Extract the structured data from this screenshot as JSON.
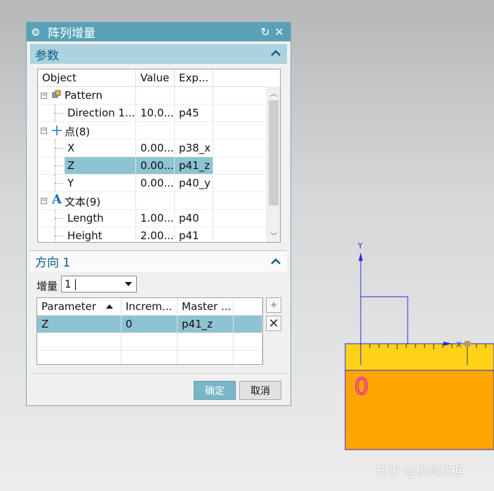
{
  "dialog": {
    "title": "阵列增量",
    "section1_title": "参数",
    "section2_title": "方向 1",
    "increment_label": "增量",
    "increment_value": "1",
    "ok_label": "确定",
    "cancel_label": "取消"
  },
  "tree": {
    "columns": [
      "Object",
      "Value",
      "Exp..."
    ],
    "rows": [
      {
        "name": "Pattern",
        "value": "",
        "exp": ""
      },
      {
        "name": "Direction 1...",
        "value": "10.0...",
        "exp": "p45"
      },
      {
        "name": "点(8)",
        "value": "",
        "exp": ""
      },
      {
        "name": "X",
        "value": "0.00...",
        "exp": "p38_x"
      },
      {
        "name": "Z",
        "value": "0.00...",
        "exp": "p41_z"
      },
      {
        "name": "Y",
        "value": "0.00...",
        "exp": "p40_y"
      },
      {
        "name": "文本(9)",
        "value": "",
        "exp": ""
      },
      {
        "name": "Length",
        "value": "1.00...",
        "exp": "p40"
      },
      {
        "name": "Height",
        "value": "2.00...",
        "exp": "p41"
      }
    ],
    "group_icon_glyph": "A"
  },
  "params_table": {
    "columns": [
      "Parameter",
      "Increm...",
      "Master ..."
    ],
    "rows": [
      {
        "parameter": "Z",
        "increment": "0",
        "master": "p41_z"
      }
    ]
  },
  "viewport": {
    "axis_y": "Y",
    "axis_x": "X",
    "digit": "0"
  },
  "watermark": "知乎 @模具数据",
  "colors": {
    "title_bar": "#5aa1b8",
    "section_bar": "#acd3dd",
    "selection": "#8ec3d2",
    "ok_button": "#79b6c8",
    "ruler_yellow": "#ffd21a",
    "body_orange": "#ffa500",
    "axis_blue": "#2b2bdd",
    "digit_magenta": "#e020c0"
  }
}
